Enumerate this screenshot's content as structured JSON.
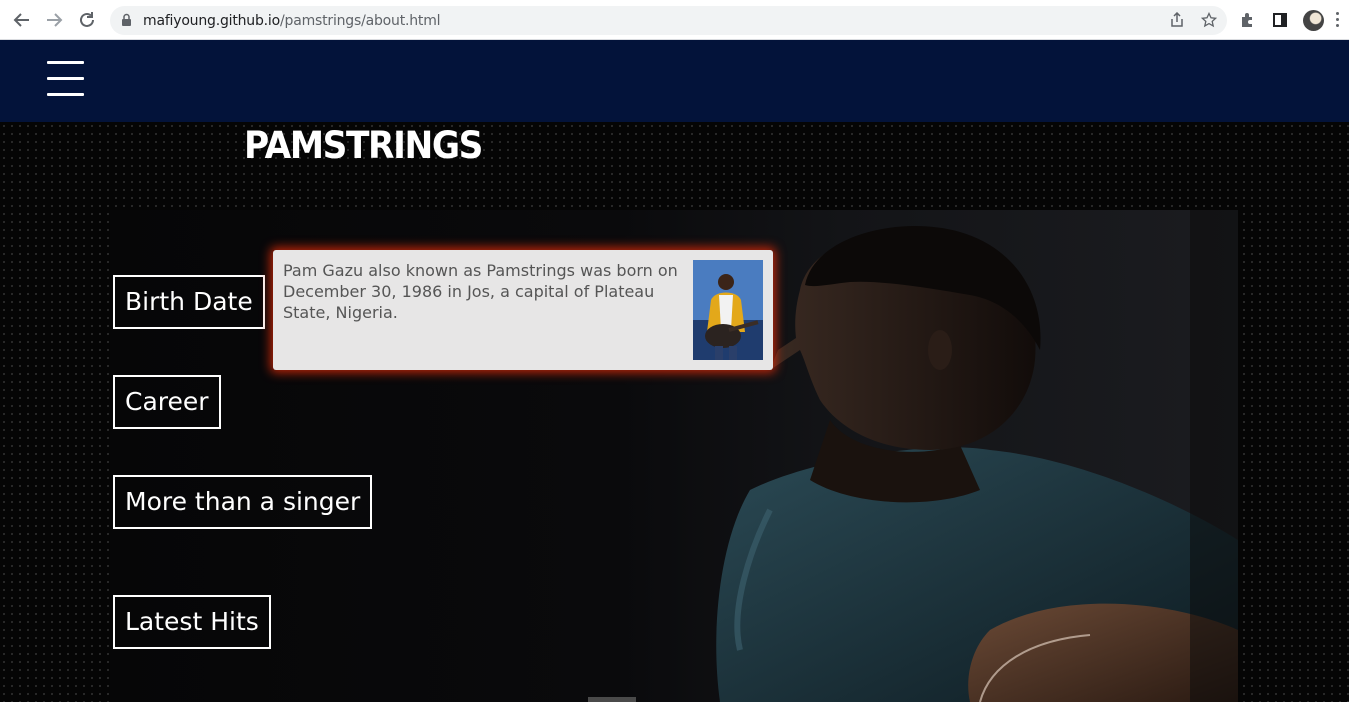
{
  "browser": {
    "url_host": "mafiyoung.github.io",
    "url_path": "/pamstrings/about.html",
    "back_icon": "arrow-left-icon",
    "forward_icon": "arrow-right-icon",
    "reload_icon": "reload-icon"
  },
  "site": {
    "logo_text": "PAMSTRINGS",
    "header_color": "#03133a",
    "menu_buttons": [
      {
        "label": "Birth Date"
      },
      {
        "label": "Career"
      },
      {
        "label": "More than a singer"
      },
      {
        "label": "Latest Hits"
      }
    ],
    "info_card": {
      "text": "Pam Gazu also known as Pamstrings was born on December 30, 1986 in Jos, a capital of Plateau State, Nigeria.",
      "glow_color": "#c8280a"
    }
  }
}
